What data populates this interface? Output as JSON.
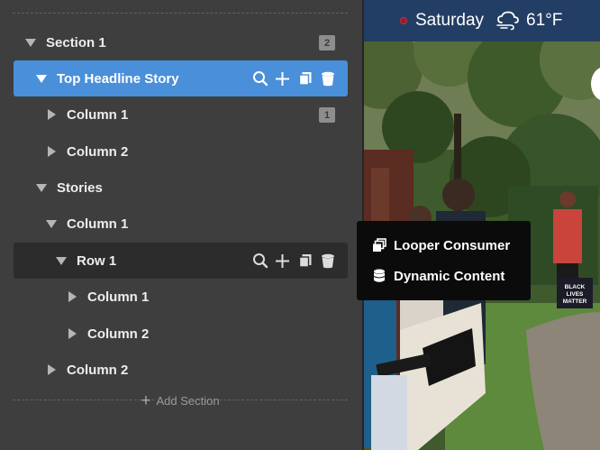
{
  "tree": {
    "rows": [
      {
        "label": "Section 1",
        "toggle": "expanded",
        "badge": "2"
      },
      {
        "label": "Top Headline Story",
        "toggle": "expanded",
        "state": "selected"
      },
      {
        "label": "Column 1",
        "toggle": "collapsed",
        "badge": "1"
      },
      {
        "label": "Column 2",
        "toggle": "collapsed"
      },
      {
        "label": "Stories",
        "toggle": "expanded"
      },
      {
        "label": "Column 1",
        "toggle": "expanded"
      },
      {
        "label": "Row 1",
        "toggle": "expanded",
        "state": "hover"
      },
      {
        "label": "Column 1",
        "toggle": "collapsed"
      },
      {
        "label": "Column 2",
        "toggle": "collapsed"
      },
      {
        "label": "Column 2",
        "toggle": "collapsed"
      }
    ],
    "row_actions": [
      "search-icon",
      "plus-icon",
      "duplicate-icon",
      "trash-icon"
    ],
    "add_section": {
      "icon": "plus-icon",
      "label": "Add Section"
    }
  },
  "preview": {
    "weather": {
      "day": "Saturday",
      "temp": "61°F",
      "icon": "cloud-wind-icon"
    },
    "sign_text": "BLACK LIVES MATTER"
  },
  "popup": {
    "items": [
      {
        "icon": "looper-icon",
        "label": "Looper Consumer"
      },
      {
        "icon": "database-icon",
        "label": "Dynamic Content"
      }
    ]
  },
  "colors": {
    "panel": "#3e3e3e",
    "selected": "#4a8fd9",
    "hover": "#2c2c2c",
    "weather_bar": "#233e64",
    "popup": "#0b0b0b"
  }
}
